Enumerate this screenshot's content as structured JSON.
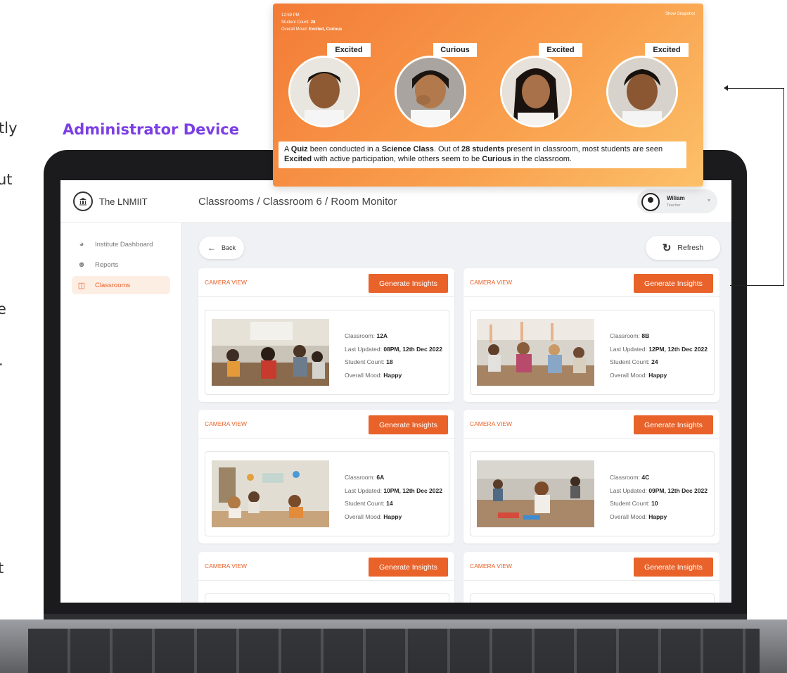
{
  "page": {
    "left_fragments": [
      "tly",
      "ut",
      "e",
      ".",
      "t"
    ],
    "device_label": "Administrator Device"
  },
  "popup": {
    "time": "12:59 PM",
    "student_count_label": "Student Count:",
    "student_count_value": "28",
    "overall_mood_label": "Overall Mood:",
    "overall_mood_value": "Excited, Curious",
    "show_snapshot": "Show Snapshot",
    "emotions": [
      "Excited",
      "Curious",
      "Excited",
      "Excited"
    ],
    "summary": {
      "p1": "A ",
      "b1": "Quiz",
      "p2": " been conducted in a ",
      "b2": "Science Class",
      "p3": ". Out of ",
      "b3": "28 students",
      "p4": " present in classroom, most students are seen ",
      "b4": "Excited",
      "p5": " with active participation, while others seem to be ",
      "b5": "Curious",
      "p6": " in the classroom."
    }
  },
  "app": {
    "brand_name": "The LNMIIT",
    "nav": [
      {
        "label": "Institute Dashboard",
        "icon": "dashboard-icon"
      },
      {
        "label": "Reports",
        "icon": "users-icon"
      },
      {
        "label": "Classrooms",
        "icon": "classroom-icon"
      }
    ],
    "active_nav": "Classrooms",
    "breadcrumb": "Classrooms / Classroom 6 / Room Monitor",
    "user": {
      "name": "Wiliam",
      "role": "Teacher"
    },
    "back_label": "Back",
    "refresh_label": "Refresh",
    "camera_label": "CAMERA VIEW",
    "generate_label": "Generate Insights",
    "field_labels": {
      "classroom": "Classroom:",
      "updated": "Last Updated:",
      "count": "Student Count:",
      "mood": "Overall Mood:"
    },
    "cards": [
      {
        "classroom": "12A",
        "updated": "08PM, 12th Dec 2022",
        "count": "18",
        "mood": "Happy"
      },
      {
        "classroom": "8B",
        "updated": "12PM, 12th Dec 2022",
        "count": "24",
        "mood": "Happy"
      },
      {
        "classroom": "6A",
        "updated": "10PM, 12th Dec 2022",
        "count": "14",
        "mood": "Happy"
      },
      {
        "classroom": "4C",
        "updated": "09PM, 12th Dec 2022",
        "count": "10",
        "mood": "Happy"
      }
    ],
    "partial_cards": 2
  },
  "colors": {
    "accent": "#e8622a",
    "device_label": "#7b3fe4",
    "popup_gradient": [
      "#f37b36",
      "#fcc069"
    ]
  }
}
